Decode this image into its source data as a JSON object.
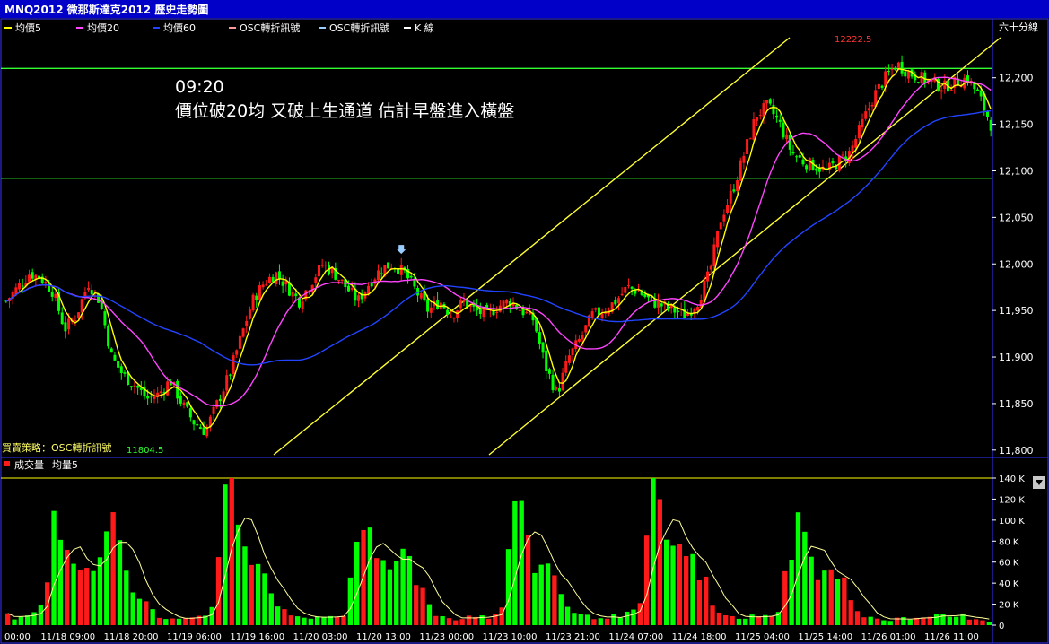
{
  "window": {
    "title": "MNQ2012 微那斯達克2012  歷史走勢圖"
  },
  "legend": {
    "items": [
      {
        "label": "均價5",
        "color": "#ffff00"
      },
      {
        "label": "均價20",
        "color": "#ff44ff"
      },
      {
        "label": "均價60",
        "color": "#2244ff"
      },
      {
        "label": "OSC轉折訊號",
        "color": "#ff9999"
      },
      {
        "label": "OSC轉折訊號",
        "color": "#99ccff"
      },
      {
        "label": "K 線",
        "color": "#ffffff"
      }
    ],
    "period": "六十分線"
  },
  "annotation": {
    "time": "09:20",
    "text": "價位破20均 又破上生通道  估計早盤進入橫盤"
  },
  "strategy_label": "買賣策略：OSC轉折訊號",
  "volume_legend": {
    "vol": "成交量",
    "avg": "均量5"
  },
  "colors": {
    "up": "#ff1a1a",
    "down": "#00ff00",
    "ma5": "#ffff00",
    "ma20": "#ff44ff",
    "ma60": "#2244ff",
    "hline": "#33ff33",
    "channel": "#ffff33",
    "frame": "#3333ff"
  },
  "chart_data": {
    "type": "candlestick",
    "price_axis": {
      "range": [
        11795,
        12245
      ],
      "ticks": [
        "12,200",
        "12,150",
        "12,100",
        "12,050",
        "12,000",
        "11,950",
        "11,900",
        "11,850",
        "11,800"
      ]
    },
    "volume_axis": {
      "range": [
        0,
        140000
      ],
      "ticks": [
        "140 K",
        "120 K",
        "100 K",
        "80 K",
        "60 K",
        "40 K",
        "20 K",
        "0"
      ]
    },
    "x_labels": [
      "00:00",
      "11/18 09:00",
      "11/18 20:00",
      "11/19 06:00",
      "11/19 16:00",
      "11/20 03:00",
      "11/20 13:00",
      "11/23 00:00",
      "11/23 10:00",
      "11/23 21:00",
      "11/24 07:00",
      "11/24 18:00",
      "11/25 04:00",
      "11/25 14:00",
      "11/26 01:00",
      "11/26 11:00"
    ],
    "horizontal_lines": [
      12210,
      12092
    ],
    "high_marker": "12222.5",
    "low_marker": "11804.5",
    "price_path": [
      11960,
      11975,
      11990,
      11985,
      11970,
      11930,
      11945,
      11980,
      11960,
      11900,
      11880,
      11870,
      11855,
      11860,
      11875,
      11850,
      11830,
      11820,
      11850,
      11880,
      11920,
      11960,
      11980,
      11990,
      11975,
      11960,
      11980,
      12000,
      11990,
      11975,
      11960,
      11980,
      11995,
      12000,
      11990,
      11970,
      11950,
      11960,
      11945,
      11960,
      11950,
      11945,
      11955,
      11960,
      11950,
      11940,
      11890,
      11860,
      11900,
      11920,
      11945,
      11950,
      11960,
      11975,
      11970,
      11960,
      11955,
      11950,
      11945,
      11960,
      11990,
      12050,
      12080,
      12120,
      12160,
      12170,
      12150,
      12120,
      12110,
      12105,
      12100,
      12110,
      12120,
      12150,
      12180,
      12200,
      12215,
      12205,
      12200,
      12195,
      12190,
      12195,
      12200,
      12180,
      12150
    ],
    "volume_shape": [
      10,
      6,
      8,
      12,
      40,
      125,
      80,
      65,
      60,
      55,
      120,
      95,
      45,
      30,
      20,
      10,
      6,
      8,
      9,
      8,
      12,
      30,
      130,
      110,
      80,
      60,
      55,
      20,
      12,
      8,
      7,
      9,
      8,
      10,
      12,
      60,
      90,
      75,
      60,
      50,
      100,
      55,
      30,
      12,
      8,
      6,
      8,
      10,
      9,
      7,
      20,
      140,
      90,
      65,
      60,
      55,
      30,
      12,
      9,
      8,
      8,
      9,
      10,
      12,
      25,
      130,
      95,
      85,
      70,
      60,
      55,
      20,
      10,
      8,
      7,
      9,
      8,
      10,
      20,
      85,
      105,
      60,
      55,
      50,
      45,
      30,
      12,
      8,
      6,
      5,
      7,
      6,
      8,
      9,
      10,
      8,
      12,
      6,
      5,
      4
    ]
  }
}
